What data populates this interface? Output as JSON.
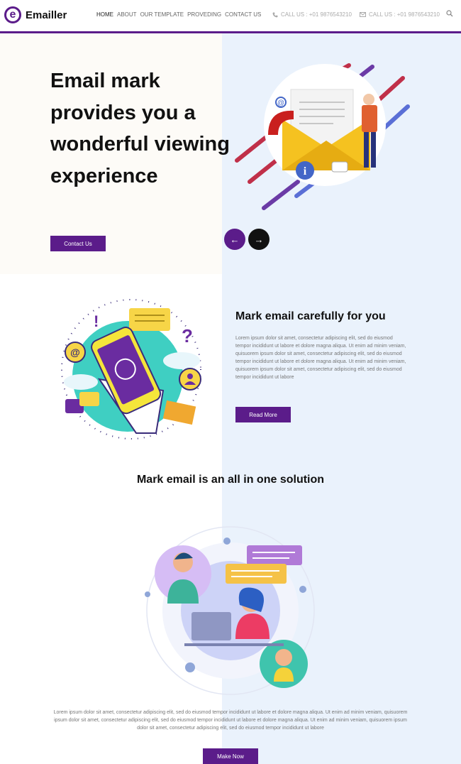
{
  "brand": {
    "logo_letter": "e",
    "name": "Emailler"
  },
  "nav": {
    "items": [
      "HOME",
      "ABOUT",
      "OUR TEMPLATE",
      "PROVEDING",
      "CONTACT US"
    ]
  },
  "contacts": [
    "CALL US : +01 9876543210",
    "CALL US : +01 9876543210"
  ],
  "hero": {
    "title": "Email mark provides you a wonderful viewing experience",
    "button": "Contact Us",
    "prev_arrow": "←",
    "next_arrow": "→"
  },
  "section2": {
    "title": "Mark email carefully for you",
    "body": "Lorem ipsum dolor sit amet, consectetur adipiscing elit, sed do eiusmod tempor incididunt ut labore et dolore magna aliqua. Ut enim ad minim veniam, quisuorem ipsum dolor sit amet, consectetur adipiscing elit, sed do eiusmod tempor incididunt ut labore et dolore magna aliqua. Ut enim ad minim veniam, quisuorem ipsum dolor sit amet, consectetur adipiscing elit, sed do eiusmod tempor incididunt ut labore",
    "button": "Read More"
  },
  "section3": {
    "title": "Mark email is an all in one solution",
    "body": "Lorem ipsum dolor sit amet, consectetur adipiscing elit, sed do eiusmod tempor incididunt ut labore et dolore magna aliqua. Ut enim ad minim veniam, quisuorem ipsum dolor sit amet, consectetur adipiscing elit, sed do eiusmod tempor incididunt ut labore et dolore magna aliqua. Ut enim ad minim veniam, quisuorem ipsum dolor sit amet, consectetur adipiscing elit, sed do eiusmod tempor incididunt ut labore",
    "button": "Make Now"
  },
  "colors": {
    "brand_purple": "#5b1c8a",
    "dark_button": "#111111",
    "panel_blue": "#eaf2fc"
  },
  "icons": [
    "phone-icon",
    "mail-icon",
    "search-icon"
  ]
}
